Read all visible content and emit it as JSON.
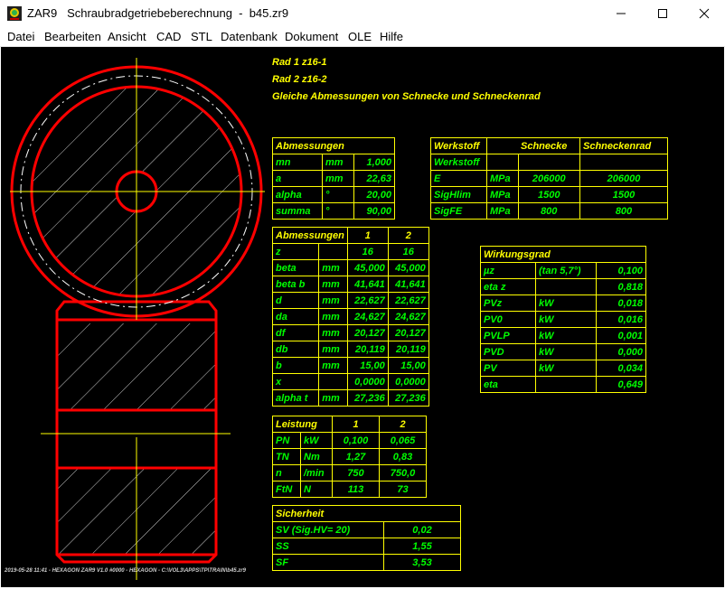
{
  "window": {
    "title": "ZAR9   Schraubradgetriebeberechnung  -  b45.zr9"
  },
  "menu": {
    "items": [
      {
        "label": "Datei"
      },
      {
        "label": "Bearbeiten"
      },
      {
        "label": "Ansicht"
      },
      {
        "label": "CAD"
      },
      {
        "label": "STL"
      },
      {
        "label": "Datenbank"
      },
      {
        "label": "Dokument"
      },
      {
        "label": "OLE"
      },
      {
        "label": "Hilfe"
      }
    ]
  },
  "header": {
    "line1": "Rad 1  z16-1",
    "line2": "Rad 2  z16-2",
    "line3": "Gleiche Abmessungen von Schnecke und Schneckenrad"
  },
  "abm1": {
    "title": "Abmessungen",
    "rows": [
      [
        "mn",
        "mm",
        "1,000"
      ],
      [
        "a",
        "mm",
        "22,63"
      ],
      [
        "alpha",
        "°",
        "20,00"
      ],
      [
        "summa",
        "°",
        "90,00"
      ]
    ]
  },
  "werkstoff": {
    "col1": "Werkstoff",
    "col2": "Schnecke",
    "col3": "Schneckenrad",
    "rows": [
      [
        "Werkstoff",
        "",
        "",
        ""
      ],
      [
        "E",
        "MPa",
        "206000",
        "206000"
      ],
      [
        "SigHlim",
        "MPa",
        "1500",
        "1500"
      ],
      [
        "SigFE",
        "MPa",
        "800",
        "800"
      ]
    ]
  },
  "abm2": {
    "title": "Abmessungen",
    "c1": "1",
    "c2": "2",
    "rows": [
      [
        "z",
        "",
        "16",
        "16"
      ],
      [
        "beta",
        "mm",
        "45,000",
        "45,000"
      ],
      [
        "beta b",
        "mm",
        "41,641",
        "41,641"
      ],
      [
        "d",
        "mm",
        "22,627",
        "22,627"
      ],
      [
        "da",
        "mm",
        "24,627",
        "24,627"
      ],
      [
        "df",
        "mm",
        "20,127",
        "20,127"
      ],
      [
        "db",
        "mm",
        "20,119",
        "20,119"
      ],
      [
        "b",
        "mm",
        "15,00",
        "15,00"
      ],
      [
        "x",
        "",
        "0,0000",
        "0,0000"
      ],
      [
        "alpha t",
        "mm",
        "27,236",
        "27,236"
      ]
    ]
  },
  "wirk": {
    "title": "Wirkungsgrad",
    "rows": [
      [
        "µz",
        "(tan 5,7°)",
        "0,100"
      ],
      [
        "eta z",
        "",
        "0,818"
      ],
      [
        "PVz",
        "kW",
        "0,018"
      ],
      [
        "PV0",
        "kW",
        "0,016"
      ],
      [
        "PVLP",
        "kW",
        "0,001"
      ],
      [
        "PVD",
        "kW",
        "0,000"
      ],
      [
        "PV",
        "kW",
        "0,034"
      ],
      [
        "eta",
        "",
        "0,649"
      ]
    ]
  },
  "leistung": {
    "title": "Leistung",
    "c1": "1",
    "c2": "2",
    "rows": [
      [
        "PN",
        "kW",
        "0,100",
        "0,065"
      ],
      [
        "TN",
        "Nm",
        "1,27",
        "0,83"
      ],
      [
        "n",
        "/min",
        "750",
        "750,0"
      ],
      [
        "FtN",
        "N",
        "113",
        "73"
      ]
    ]
  },
  "sicherheit": {
    "title": "Sicherheit",
    "rows": [
      [
        "SV (Sig.HV= 20)",
        "0,02"
      ],
      [
        "SS",
        "1,55"
      ],
      [
        "SF",
        "3,53"
      ]
    ]
  },
  "footer": {
    "text": "2019-05-28 11:41 - HEXAGON ZAR9 V1.0 #0000 - HEXAGON - C:\\VOL3\\APPS\\TP\\TRAIN\\b45.zr9"
  },
  "colors": {
    "background": "#000000",
    "drawing": "#ff0000",
    "grid": "#ffff00",
    "text_label": "#ffff00",
    "text_value": "#00ff00"
  }
}
